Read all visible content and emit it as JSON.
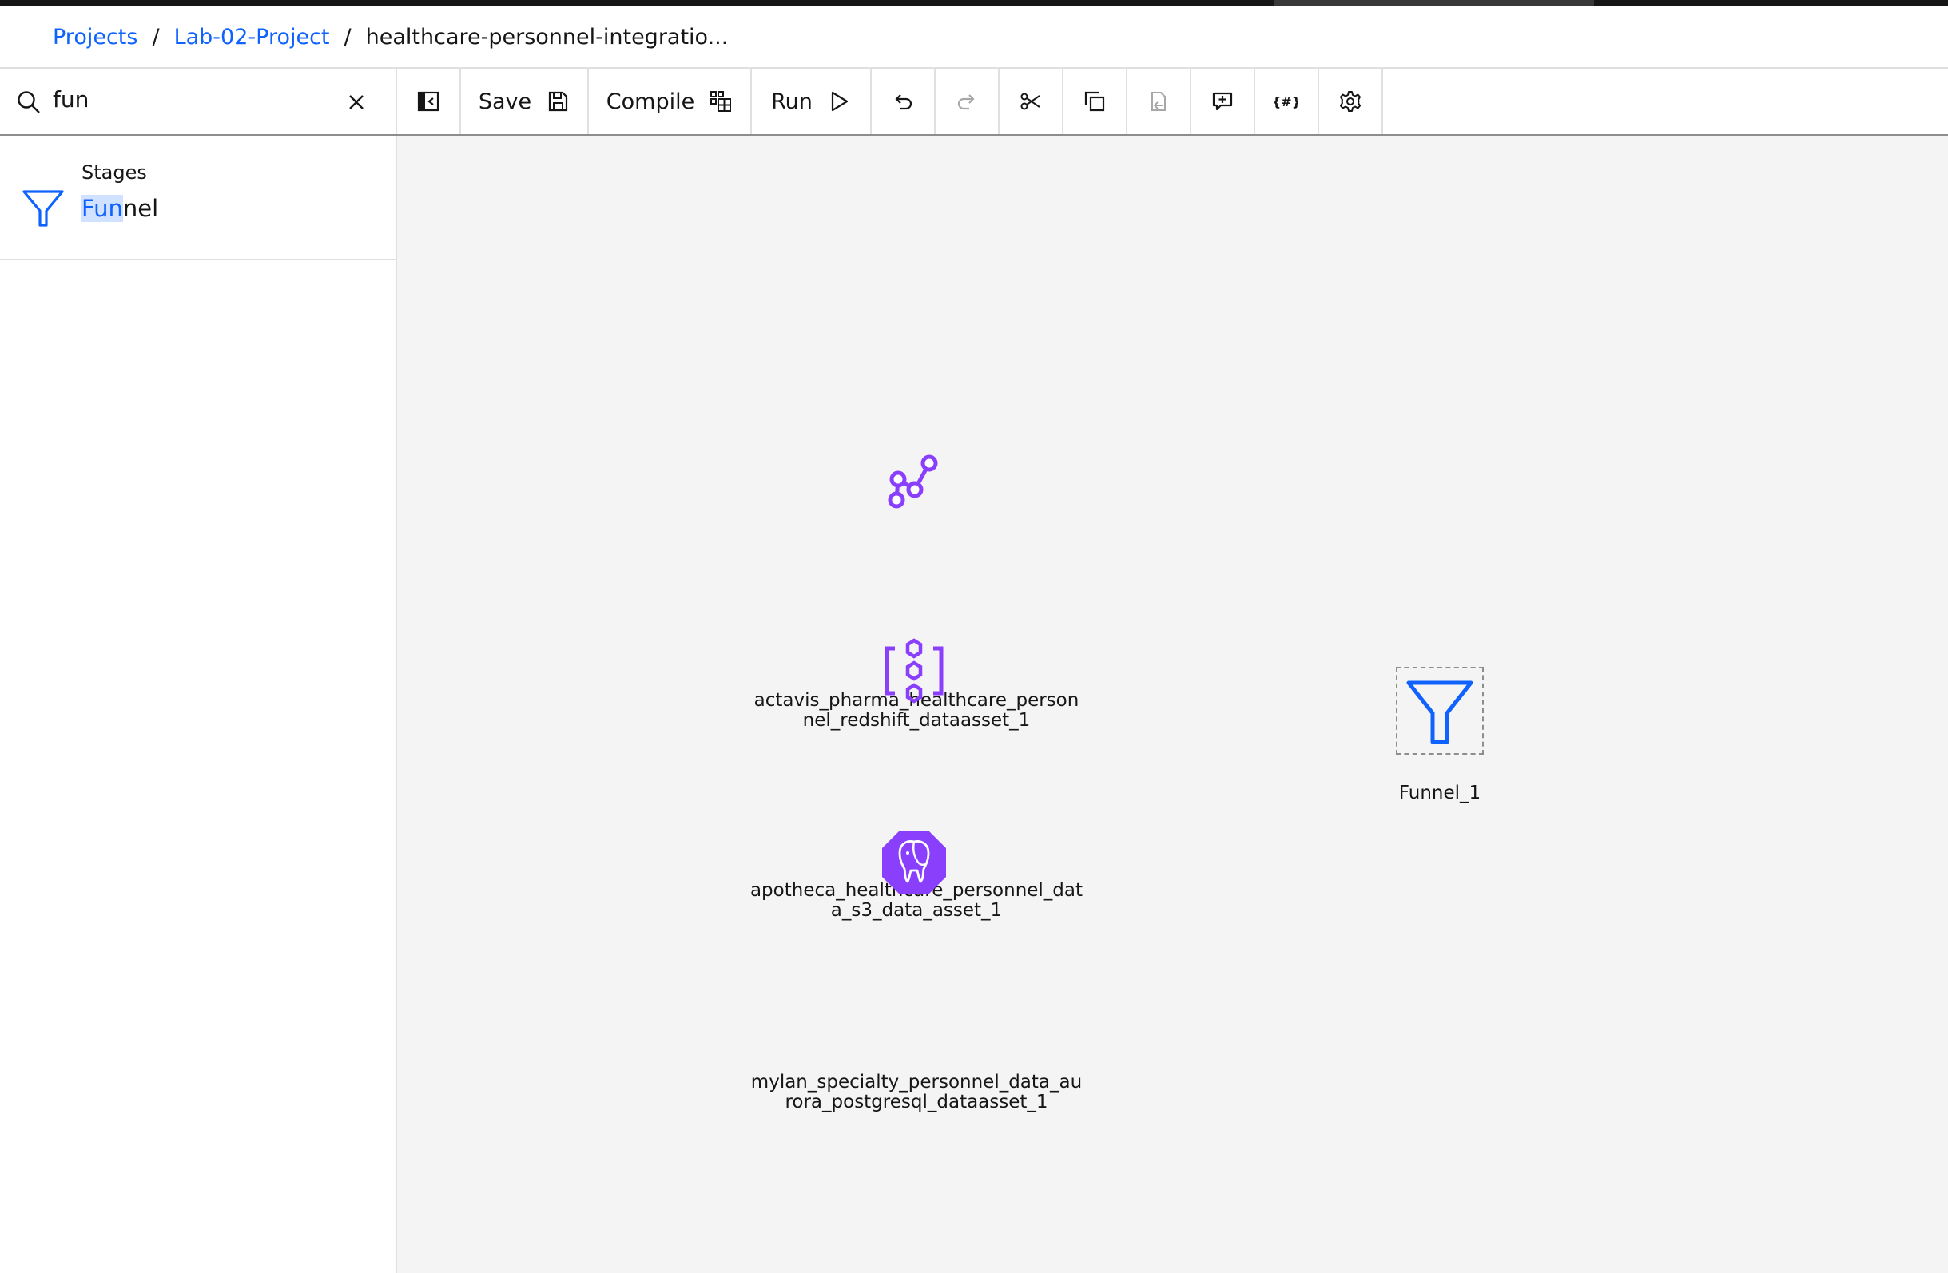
{
  "breadcrumb": {
    "projects": "Projects",
    "project": "Lab-02-Project",
    "current": "healthcare-personnel-integratio...",
    "separator": "/"
  },
  "search": {
    "value": "fun",
    "icon": "search-icon",
    "clear_icon": "close-icon"
  },
  "toolbar": {
    "save_label": "Save",
    "compile_label": "Compile",
    "run_label": "Run"
  },
  "palette": {
    "category": "Stages",
    "item_highlight": "Fun",
    "item_rest": "nel",
    "item_icon": "funnel-icon"
  },
  "canvas": {
    "nodes": [
      {
        "label": "actavis_pharma_healthcare_personnel_redshift_dataasset_1",
        "icon": "redshift-icon"
      },
      {
        "label": "apotheca_healthcare_personnel_data_s3_data_asset_1",
        "icon": "s3-icon"
      },
      {
        "label": "mylan_specialty_personnel_data_aurora_postgresql_dataasset_1",
        "icon": "postgresql-icon"
      },
      {
        "label": "Funnel_1",
        "icon": "funnel-icon"
      }
    ]
  },
  "colors": {
    "link": "#0f62fe",
    "highlight": "#d0e2ff",
    "purple": "#8a3ffc",
    "blue": "#0f62fe",
    "canvas_bg": "#f4f4f4"
  }
}
